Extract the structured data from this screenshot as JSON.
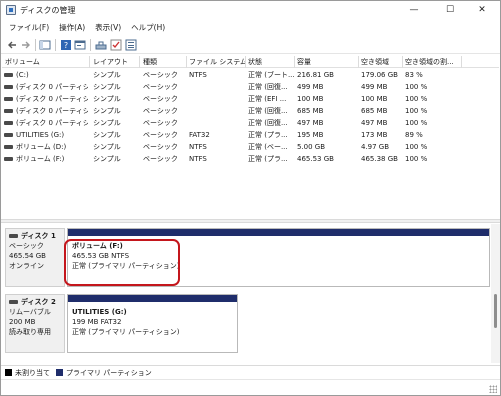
{
  "window": {
    "title": "ディスクの管理"
  },
  "titlebar": {
    "minimize": "—",
    "maximize": "☐",
    "close": "✕"
  },
  "menu": [
    "ファイル(F)",
    "操作(A)",
    "表示(V)",
    "ヘルプ(H)"
  ],
  "toolbar": {
    "icons": [
      "back-arrow-icon",
      "forward-arrow-icon",
      "console-tree-icon",
      "help-icon",
      "properties-icon",
      "connect-icon",
      "check-icon",
      "list-view-icon"
    ]
  },
  "columns": [
    "ボリューム",
    "レイアウト",
    "種類",
    "ファイル システム",
    "状態",
    "容量",
    "空き領域",
    "空き領域の割..."
  ],
  "volumes": [
    {
      "name": "(C:)",
      "layout": "シンプル",
      "type": "ベーシック",
      "fs": "NTFS",
      "status": "正常 (ブート...",
      "capacity": "216.81 GB",
      "free": "179.06 GB",
      "pct": "83 %"
    },
    {
      "name": "(ディスク 0 パーティシ...",
      "layout": "シンプル",
      "type": "ベーシック",
      "fs": "",
      "status": "正常 (回復...",
      "capacity": "499 MB",
      "free": "499 MB",
      "pct": "100 %"
    },
    {
      "name": "(ディスク 0 パーティシ...",
      "layout": "シンプル",
      "type": "ベーシック",
      "fs": "",
      "status": "正常 (EFI ...",
      "capacity": "100 MB",
      "free": "100 MB",
      "pct": "100 %"
    },
    {
      "name": "(ディスク 0 パーティシ...",
      "layout": "シンプル",
      "type": "ベーシック",
      "fs": "",
      "status": "正常 (回復...",
      "capacity": "685 MB",
      "free": "685 MB",
      "pct": "100 %"
    },
    {
      "name": "(ディスク 0 パーティシ...",
      "layout": "シンプル",
      "type": "ベーシック",
      "fs": "",
      "status": "正常 (回復...",
      "capacity": "497 MB",
      "free": "497 MB",
      "pct": "100 %"
    },
    {
      "name": "UTILITIES (G:)",
      "layout": "シンプル",
      "type": "ベーシック",
      "fs": "FAT32",
      "status": "正常 (プラ...",
      "capacity": "195 MB",
      "free": "173 MB",
      "pct": "89 %"
    },
    {
      "name": "ボリューム (D:)",
      "layout": "シンプル",
      "type": "ベーシック",
      "fs": "NTFS",
      "status": "正常 (ベー...",
      "capacity": "5.00 GB",
      "free": "4.97 GB",
      "pct": "100 %"
    },
    {
      "name": "ボリューム (F:)",
      "layout": "シンプル",
      "type": "ベーシック",
      "fs": "NTFS",
      "status": "正常 (プラ...",
      "capacity": "465.53 GB",
      "free": "465.38 GB",
      "pct": "100 %"
    }
  ],
  "disks": [
    {
      "name": "ディスク 1",
      "kind": "ベーシック",
      "size": "465.54 GB",
      "state": "オンライン",
      "partition": {
        "title": "ボリューム (F:)",
        "detail": "465.53 GB NTFS",
        "status": "正常 (プライマリ パーティション)"
      }
    },
    {
      "name": "ディスク 2",
      "kind": "リムーバブル",
      "size": "200 MB",
      "state": "読み取り専用",
      "partition": {
        "title": "UTILITIES (G:)",
        "detail": "199 MB FAT32",
        "status": "正常 (プライマリ パーティション)"
      }
    }
  ],
  "legend": [
    {
      "label": "未割り当て",
      "color": "#000000"
    },
    {
      "label": "プライマリ パーティション",
      "color": "#1f2d6b"
    }
  ]
}
